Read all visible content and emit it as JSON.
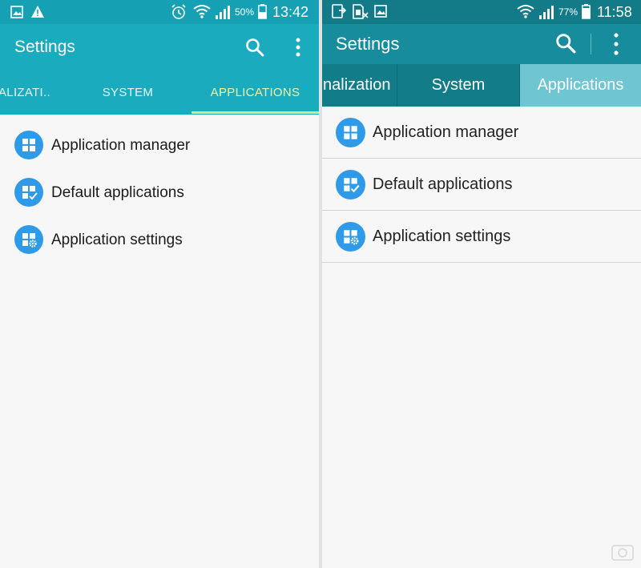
{
  "left": {
    "status_bar": {
      "battery_percent": "50%",
      "time": "13:42",
      "icons": [
        "gallery-icon",
        "warning-icon",
        "alarm-icon",
        "wifi-icon",
        "signal-icon",
        "battery-icon"
      ]
    },
    "app_bar": {
      "title": "Settings"
    },
    "tabs": [
      {
        "label": "ALIZATI..",
        "active": false
      },
      {
        "label": "SYSTEM",
        "active": false
      },
      {
        "label": "APPLICATIONS",
        "active": true
      }
    ],
    "items": [
      {
        "label": "Application manager",
        "icon": "grid-icon"
      },
      {
        "label": "Default applications",
        "icon": "grid-check-icon"
      },
      {
        "label": "Application settings",
        "icon": "grid-gear-icon"
      }
    ]
  },
  "right": {
    "status_bar": {
      "battery_percent": "77%",
      "time": "11:58",
      "icons": [
        "download-icon",
        "sim-off-icon",
        "gallery-icon",
        "wifi-icon",
        "signal-icon",
        "battery-icon"
      ]
    },
    "app_bar": {
      "title": "Settings"
    },
    "tabs": [
      {
        "label": "nalization",
        "active": false
      },
      {
        "label": "System",
        "active": false
      },
      {
        "label": "Applications",
        "active": true
      }
    ],
    "items": [
      {
        "label": "Application manager",
        "icon": "grid-icon"
      },
      {
        "label": "Default applications",
        "icon": "grid-check-icon"
      },
      {
        "label": "Application settings",
        "icon": "grid-gear-icon"
      }
    ]
  },
  "colors": {
    "left_header": "#1aabbf",
    "right_header": "#168c9c",
    "right_active_tab": "#6fc5d2",
    "active_tab_text": "#f2f59b",
    "icon_circle": "#2e9ae8"
  }
}
